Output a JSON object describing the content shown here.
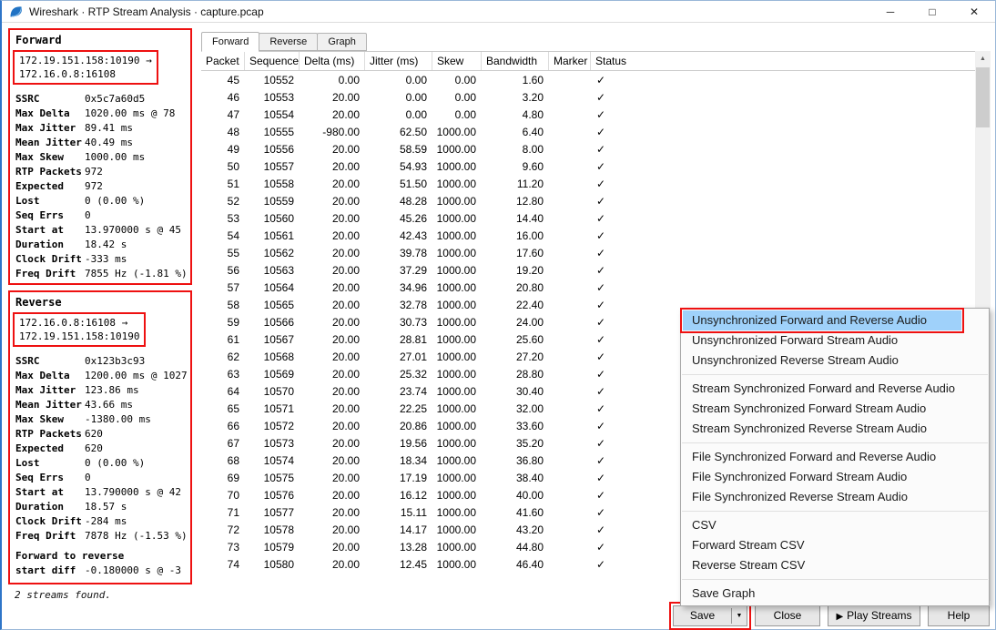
{
  "titlebar": {
    "title": "Wireshark · RTP Stream Analysis · capture.pcap",
    "minimize": "─",
    "maximize": "□",
    "close": "✕"
  },
  "tabs": [
    "Forward",
    "Reverse",
    "Graph"
  ],
  "sidebar": {
    "forward": {
      "title": "Forward",
      "stream_line1": "172.19.151.158:10190 →",
      "stream_line2": "172.16.0.8:16108",
      "stats": [
        {
          "label": "SSRC",
          "value": "0x5c7a60d5"
        },
        {
          "label": "Max Delta",
          "value": "1020.00 ms @ 78"
        },
        {
          "label": "Max Jitter",
          "value": "89.41 ms"
        },
        {
          "label": "Mean Jitter",
          "value": "40.49 ms"
        },
        {
          "label": "Max Skew",
          "value": "1000.00 ms"
        },
        {
          "label": "RTP Packets",
          "value": "972"
        },
        {
          "label": "Expected",
          "value": "972"
        },
        {
          "label": "Lost",
          "value": "0 (0.00 %)"
        },
        {
          "label": "Seq Errs",
          "value": "0"
        },
        {
          "label": "Start at",
          "value": "13.970000 s @ 45"
        },
        {
          "label": "Duration",
          "value": "18.42 s"
        },
        {
          "label": "Clock Drift",
          "value": "-333 ms"
        },
        {
          "label": "Freq Drift",
          "value": "7855 Hz (-1.81 %)"
        }
      ]
    },
    "reverse": {
      "title": "Reverse",
      "stream_line1": "172.16.0.8:16108 →",
      "stream_line2": "172.19.151.158:10190",
      "stats": [
        {
          "label": "SSRC",
          "value": "0x123b3c93"
        },
        {
          "label": "Max Delta",
          "value": "1200.00 ms @ 1027"
        },
        {
          "label": "Max Jitter",
          "value": "123.86 ms"
        },
        {
          "label": "Mean Jitter",
          "value": "43.66 ms"
        },
        {
          "label": "Max Skew",
          "value": "-1380.00 ms"
        },
        {
          "label": "RTP Packets",
          "value": "620"
        },
        {
          "label": "Expected",
          "value": "620"
        },
        {
          "label": "Lost",
          "value": "0 (0.00 %)"
        },
        {
          "label": "Seq Errs",
          "value": "0"
        },
        {
          "label": "Start at",
          "value": "13.790000 s @ 42"
        },
        {
          "label": "Duration",
          "value": "18.57 s"
        },
        {
          "label": "Clock Drift",
          "value": "-284 ms"
        },
        {
          "label": "Freq Drift",
          "value": "7878 Hz (-1.53 %)"
        }
      ],
      "extra_title": "Forward to reverse",
      "extra_stat": {
        "label": "start diff",
        "value": "-0.180000 s @ -3"
      }
    },
    "footer": "2 streams found."
  },
  "table": {
    "columns": [
      "Packet",
      "Sequence",
      "Delta (ms)",
      "Jitter (ms)",
      "Skew",
      "Bandwidth",
      "Marker",
      "Status"
    ],
    "status_glyph": "✓",
    "rows": [
      [
        "45",
        "10552",
        "0.00",
        "0.00",
        "0.00",
        "1.60"
      ],
      [
        "46",
        "10553",
        "20.00",
        "0.00",
        "0.00",
        "3.20"
      ],
      [
        "47",
        "10554",
        "20.00",
        "0.00",
        "0.00",
        "4.80"
      ],
      [
        "48",
        "10555",
        "-980.00",
        "62.50",
        "1000.00",
        "6.40"
      ],
      [
        "49",
        "10556",
        "20.00",
        "58.59",
        "1000.00",
        "8.00"
      ],
      [
        "50",
        "10557",
        "20.00",
        "54.93",
        "1000.00",
        "9.60"
      ],
      [
        "51",
        "10558",
        "20.00",
        "51.50",
        "1000.00",
        "11.20"
      ],
      [
        "52",
        "10559",
        "20.00",
        "48.28",
        "1000.00",
        "12.80"
      ],
      [
        "53",
        "10560",
        "20.00",
        "45.26",
        "1000.00",
        "14.40"
      ],
      [
        "54",
        "10561",
        "20.00",
        "42.43",
        "1000.00",
        "16.00"
      ],
      [
        "55",
        "10562",
        "20.00",
        "39.78",
        "1000.00",
        "17.60"
      ],
      [
        "56",
        "10563",
        "20.00",
        "37.29",
        "1000.00",
        "19.20"
      ],
      [
        "57",
        "10564",
        "20.00",
        "34.96",
        "1000.00",
        "20.80"
      ],
      [
        "58",
        "10565",
        "20.00",
        "32.78",
        "1000.00",
        "22.40"
      ],
      [
        "59",
        "10566",
        "20.00",
        "30.73",
        "1000.00",
        "24.00"
      ],
      [
        "61",
        "10567",
        "20.00",
        "28.81",
        "1000.00",
        "25.60"
      ],
      [
        "62",
        "10568",
        "20.00",
        "27.01",
        "1000.00",
        "27.20"
      ],
      [
        "63",
        "10569",
        "20.00",
        "25.32",
        "1000.00",
        "28.80"
      ],
      [
        "64",
        "10570",
        "20.00",
        "23.74",
        "1000.00",
        "30.40"
      ],
      [
        "65",
        "10571",
        "20.00",
        "22.25",
        "1000.00",
        "32.00"
      ],
      [
        "66",
        "10572",
        "20.00",
        "20.86",
        "1000.00",
        "33.60"
      ],
      [
        "67",
        "10573",
        "20.00",
        "19.56",
        "1000.00",
        "35.20"
      ],
      [
        "68",
        "10574",
        "20.00",
        "18.34",
        "1000.00",
        "36.80"
      ],
      [
        "69",
        "10575",
        "20.00",
        "17.19",
        "1000.00",
        "38.40"
      ],
      [
        "70",
        "10576",
        "20.00",
        "16.12",
        "1000.00",
        "40.00"
      ],
      [
        "71",
        "10577",
        "20.00",
        "15.11",
        "1000.00",
        "41.60"
      ],
      [
        "72",
        "10578",
        "20.00",
        "14.17",
        "1000.00",
        "43.20"
      ],
      [
        "73",
        "10579",
        "20.00",
        "13.28",
        "1000.00",
        "44.80"
      ],
      [
        "74",
        "10580",
        "20.00",
        "12.45",
        "1000.00",
        "46.40"
      ]
    ]
  },
  "context_menu": {
    "highlighted_index": 0,
    "groups": [
      [
        "Unsynchronized Forward and Reverse Audio",
        "Unsynchronized Forward Stream Audio",
        "Unsynchronized Reverse Stream Audio"
      ],
      [
        "Stream Synchronized Forward and Reverse Audio",
        "Stream Synchronized Forward Stream Audio",
        "Stream Synchronized Reverse Stream Audio"
      ],
      [
        "File Synchronized Forward and Reverse Audio",
        "File Synchronized Forward Stream Audio",
        "File Synchronized Reverse Stream Audio"
      ],
      [
        "CSV",
        "Forward Stream CSV",
        "Reverse Stream CSV"
      ],
      [
        "Save Graph"
      ]
    ]
  },
  "footer_buttons": {
    "save": "Save",
    "save_arrow": "▼",
    "close": "Close",
    "play_icon": "▶",
    "play": "Play Streams",
    "help": "Help"
  },
  "scrollbar": {
    "up": "▲",
    "down": "▼"
  },
  "colors": {
    "annotation_red": "#ee1111",
    "menu_highlight": "#9fd1fa",
    "window_accent": "#2e75c8"
  }
}
